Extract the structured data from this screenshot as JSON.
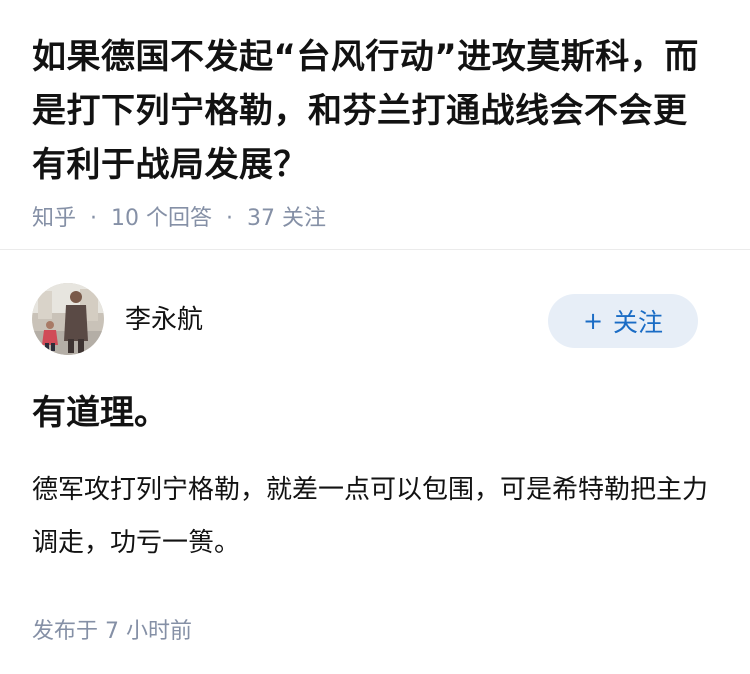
{
  "question": {
    "title": "如果德国不发起“台风行动”进攻莫斯科，而是打下列宁格勒，和芬兰打通战线会不会更有利于战局发展？",
    "source": "知乎",
    "separator": "·",
    "answers_count": "10 个回答",
    "followers_count": "37 关注"
  },
  "answer": {
    "author_name": "李永航",
    "follow_plus": "+",
    "follow_label": "关注",
    "headline": "有道理。",
    "body": "德军攻打列宁格勒，就差一点可以包围，可是希特勒把主力调走，功亏一篑。",
    "published": "发布于 7 小时前"
  },
  "colors": {
    "text": "#121212",
    "meta": "#8590a6",
    "accent": "#1a6cc5",
    "follow_bg": "#e7eef7",
    "divider": "#ebebeb"
  },
  "icons": {
    "avatar": "author-photo"
  }
}
